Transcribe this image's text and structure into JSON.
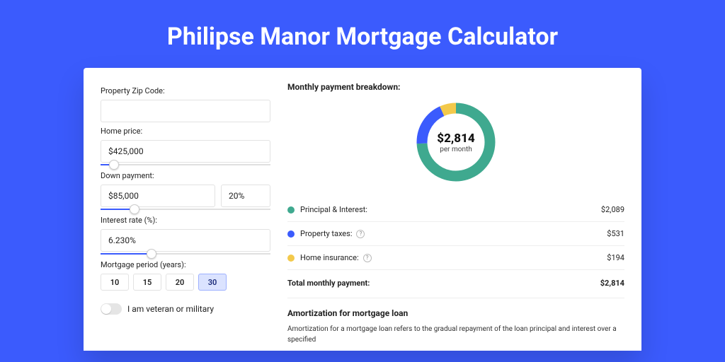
{
  "page_title": "Philipse Manor Mortgage Calculator",
  "colors": {
    "principal": "#3fa98f",
    "taxes": "#3b5bfd",
    "insurance": "#f3c94b"
  },
  "form": {
    "zip": {
      "label": "Property Zip Code:",
      "value": ""
    },
    "home_price": {
      "label": "Home price:",
      "value": "$425,000",
      "slider_pct": 8
    },
    "down_payment": {
      "label": "Down payment:",
      "value": "$85,000",
      "pct_value": "20%",
      "slider_pct": 20
    },
    "interest_rate": {
      "label": "Interest rate (%):",
      "value": "6.230%",
      "slider_pct": 30
    },
    "mortgage_period": {
      "label": "Mortgage period (years):",
      "options": [
        "10",
        "15",
        "20",
        "30"
      ],
      "active": "30"
    },
    "veteran": {
      "label": "I am veteran or military",
      "checked": false
    }
  },
  "breakdown": {
    "title": "Monthly payment breakdown:",
    "center_amount": "$2,814",
    "center_sub": "per month",
    "items": [
      {
        "label": "Principal & Interest:",
        "value": "$2,089",
        "info": false,
        "color_key": "principal"
      },
      {
        "label": "Property taxes:",
        "value": "$531",
        "info": true,
        "color_key": "taxes"
      },
      {
        "label": "Home insurance:",
        "value": "$194",
        "info": true,
        "color_key": "insurance"
      }
    ],
    "total_label": "Total monthly payment:",
    "total_value": "$2,814"
  },
  "amortization": {
    "title": "Amortization for mortgage loan",
    "text": "Amortization for a mortgage loan refers to the gradual repayment of the loan principal and interest over a specified"
  },
  "chart_data": {
    "type": "pie",
    "title": "Monthly payment breakdown",
    "categories": [
      "Principal & Interest",
      "Property taxes",
      "Home insurance"
    ],
    "values": [
      2089,
      531,
      194
    ],
    "total": 2814,
    "colors": [
      "#3fa98f",
      "#3b5bfd",
      "#f3c94b"
    ]
  }
}
